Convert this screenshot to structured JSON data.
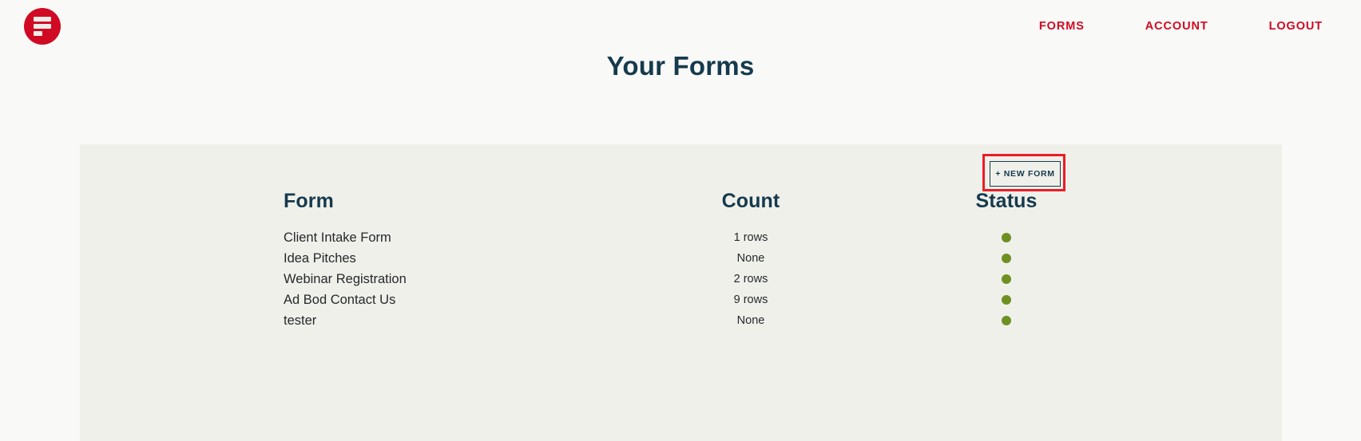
{
  "header": {
    "logo_icon": "forms-logo-icon",
    "nav": [
      {
        "label": "FORMS"
      },
      {
        "label": "ACCOUNT"
      },
      {
        "label": "LOGOUT"
      }
    ]
  },
  "page": {
    "title": "Your Forms"
  },
  "toolbar": {
    "new_form_label": "+ NEW FORM"
  },
  "table": {
    "headers": {
      "form": "Form",
      "count": "Count",
      "status": "Status"
    },
    "rows": [
      {
        "form": "Client Intake Form",
        "count": "1 rows",
        "status": "active"
      },
      {
        "form": "Idea Pitches",
        "count": "None",
        "status": "active"
      },
      {
        "form": "Webinar Registration",
        "count": "2 rows",
        "status": "active"
      },
      {
        "form": "Ad Bod Contact Us",
        "count": "9 rows",
        "status": "active"
      },
      {
        "form": "tester",
        "count": "None",
        "status": "active"
      }
    ]
  },
  "colors": {
    "brand_red": "#D00A23",
    "annotation_red": "#ED1C24",
    "title_navy": "#163A4D",
    "status_green": "#6E9022",
    "page_bg": "#F9F9F7",
    "card_bg": "#F0F0EB"
  }
}
